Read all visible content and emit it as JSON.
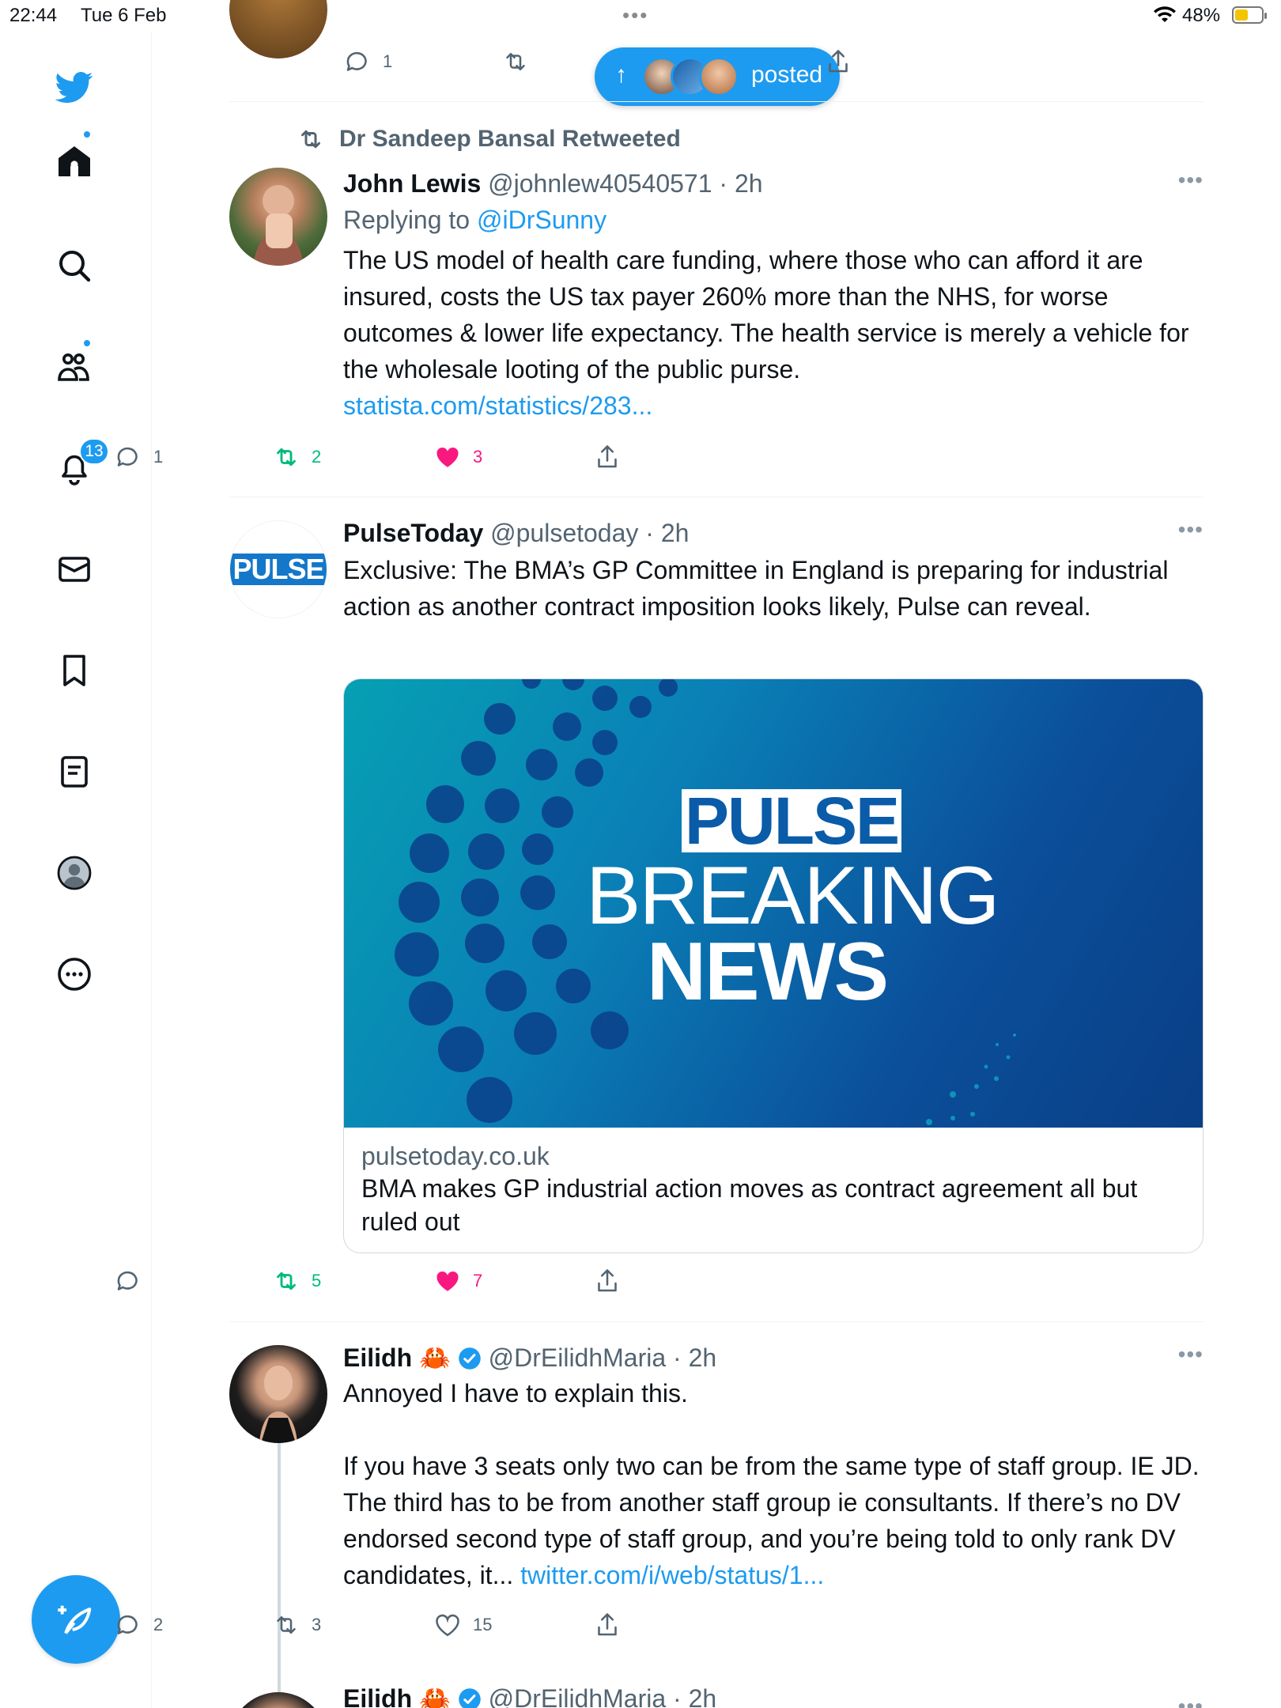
{
  "status_bar": {
    "time": "22:44",
    "date": "Tue 6 Feb",
    "battery_pct": "48%",
    "battery_level": 0.48
  },
  "sidebar": {
    "items": [
      {
        "name": "twitter-logo",
        "icon": "bird-icon"
      },
      {
        "name": "home",
        "icon": "home-icon",
        "has_dot": true
      },
      {
        "name": "explore",
        "icon": "search-icon"
      },
      {
        "name": "communities",
        "icon": "people-icon",
        "has_dot": true
      },
      {
        "name": "notifications",
        "icon": "bell-icon",
        "badge": "13"
      },
      {
        "name": "messages",
        "icon": "mail-icon"
      },
      {
        "name": "bookmarks",
        "icon": "bookmark-icon"
      },
      {
        "name": "lists",
        "icon": "list-icon"
      },
      {
        "name": "profile",
        "icon": "profile-icon"
      },
      {
        "name": "more",
        "icon": "more-circle-icon"
      }
    ],
    "compose_icon": "compose-icon"
  },
  "posted_pill": {
    "label": "posted",
    "arrow": "↑"
  },
  "top_tweet_actions": {
    "replies": "1"
  },
  "tweets": [
    {
      "retweeted_by": "Dr Sandeep Bansal Retweeted",
      "name": "John Lewis",
      "handle": "@johnlew40540571",
      "time": "· 2h",
      "replying_label": "Replying to",
      "replying_to": "@iDrSunny",
      "text": "The US model of health care funding, where those who can afford it are insured, costs the US tax payer 260% more than the NHS, for worse outcomes & lower life expectancy. The health service is merely a vehicle for the wholesale looting of the public purse.",
      "link": "statista.com/statistics/283...",
      "replies": "1",
      "retweets": "2",
      "likes": "3",
      "liked": true
    },
    {
      "name": "PulseToday",
      "handle": "@pulsetoday",
      "time": "· 2h",
      "avatar_text": "PULSE",
      "text": "Exclusive: The BMA’s GP Committee in England is preparing for industrial action as another contract imposition looks likely, Pulse can reveal.",
      "card": {
        "image_line1": "PULSE",
        "image_line2": "BREAKING",
        "image_line3": "NEWS",
        "domain": "pulsetoday.co.uk",
        "title": "BMA makes GP industrial action moves as contract agreement all but ruled out"
      },
      "replies": "",
      "retweets": "5",
      "likes": "7",
      "liked": true
    },
    {
      "name": "Eilidh",
      "emoji": "🦀",
      "verified": true,
      "handle": "@DrEilidhMaria",
      "time": "· 2h",
      "text_p1": "Annoyed I have to explain this.",
      "text_p2": "If you have 3 seats only two can be from the same type of staff group. IE JD. The third has to be from another staff group ie consultants. If there’s no DV endorsed second type of staff group, and you’re being told to only rank DV candidates, it...",
      "link": "twitter.com/i/web/status/1...",
      "replies": "2",
      "retweets": "3",
      "likes": "15",
      "liked": false
    },
    {
      "name": "Eilidh",
      "emoji": "🦀",
      "verified": true,
      "handle": "@DrEilidhMaria",
      "time": "· 2h"
    }
  ],
  "colors": {
    "accent": "#1d9bf0",
    "retweet": "#00ba7c",
    "like": "#f91880",
    "secondary_text": "#536471"
  }
}
